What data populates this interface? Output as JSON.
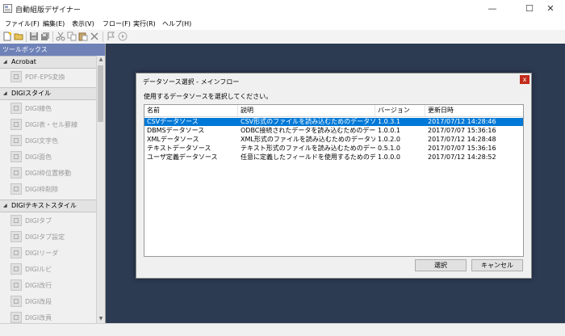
{
  "window": {
    "title": "自動組版デザイナー",
    "minimize": "—",
    "maximize": "☐",
    "close": "✕"
  },
  "menu": [
    {
      "label": "ファイル(F)"
    },
    {
      "label": "編集(E)"
    },
    {
      "label": "表示(V)"
    },
    {
      "label": "フロー(F)"
    },
    {
      "label": "実行(R)"
    },
    {
      "label": "ヘルプ(H)"
    }
  ],
  "toolbox": {
    "title": "ツールボックス",
    "categories": [
      {
        "label": "Acrobat",
        "tools": [
          {
            "label": "PDF-EPS変換"
          }
        ]
      },
      {
        "label": "DIGIスタイル",
        "tools": [
          {
            "label": "DIGI線色"
          },
          {
            "label": "DIGI表・セル罫線"
          },
          {
            "label": "DIGI文字色"
          },
          {
            "label": "DIGI面色"
          },
          {
            "label": "DIGI枠位置移動"
          },
          {
            "label": "DIGI枠削除"
          }
        ]
      },
      {
        "label": "DIGIテキストスタイル",
        "tools": [
          {
            "label": "DIGIタブ"
          },
          {
            "label": "DIGIタブ設定"
          },
          {
            "label": "DIGIリーダ"
          },
          {
            "label": "DIGIルビ"
          },
          {
            "label": "DIGI改行"
          },
          {
            "label": "DIGI改段"
          },
          {
            "label": "DIGI改頁"
          }
        ]
      }
    ]
  },
  "dialog": {
    "title": "データソース選択 - メインフロー",
    "close": "x",
    "prompt": "使用するデータソースを選択してください。",
    "columns": [
      "名前",
      "説明",
      "バージョン",
      "更新日時"
    ],
    "rows": [
      {
        "name": "CSVデータソース",
        "desc": "CSV形式のファイルを読み込むためのデータソ...",
        "version": "1.0.3.1",
        "updated": "2017/07/12 14:28:46",
        "selected": true
      },
      {
        "name": "DBMSデータソース",
        "desc": "ODBC接続されたデータを読み込むためのデー...",
        "version": "1.0.0.1",
        "updated": "2017/07/07 15:36:16"
      },
      {
        "name": "XMLデータソース",
        "desc": "XML形式のファイルを読み込むためのデータソ...",
        "version": "1.0.2.0",
        "updated": "2017/07/12 14:28:48"
      },
      {
        "name": "テキストデータソース",
        "desc": "テキスト形式のファイルを読み込むためのデータ...",
        "version": "0.5.1.0",
        "updated": "2017/07/07 15:36:16"
      },
      {
        "name": "ユーザ定義データソース",
        "desc": "任意に定義したフィールドを使用するためのデ...",
        "version": "1.0.0.0",
        "updated": "2017/07/12 14:28:52"
      }
    ],
    "select_label": "選択",
    "cancel_label": "キャンセル"
  },
  "colors": {
    "workspace": "#2c3a52",
    "toolbox_header": "#6e82b8",
    "selection": "#0078d7"
  }
}
